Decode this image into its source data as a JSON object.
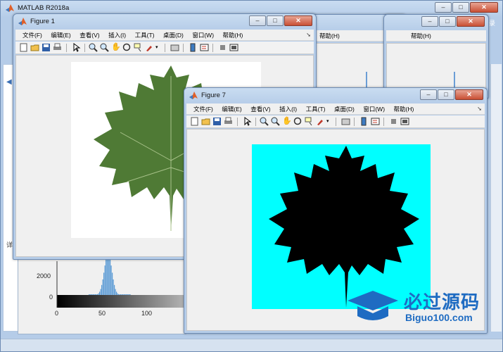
{
  "desktop": {
    "background_color": "#9ec4e4"
  },
  "matlab_window": {
    "title": "MATLAB R2018a",
    "login_fragment": "录"
  },
  "histogram_axes": {
    "y_ticks": [
      "2000",
      "0"
    ],
    "x_ticks": [
      "0",
      "50",
      "100"
    ],
    "bar_color": "#5b9bd5"
  },
  "menu_labels": {
    "file": "文件(F)",
    "edit": "编辑(E)",
    "view": "查看(V)",
    "insert": "插入(I)",
    "tools": "工具(T)",
    "desktop": "桌面(D)",
    "window": "窗口(W)",
    "help": "帮助(H)"
  },
  "figure1": {
    "title": "Figure 1",
    "image_description_icon": "maple-leaf-green"
  },
  "figure7": {
    "title": "Figure 7",
    "image_description_icon": "maple-leaf-silhouette",
    "background_color": "#00ffff"
  },
  "background_figures": {
    "help_label_1": "帮助(H)",
    "help_label_2": "帮助(H)"
  },
  "watermark": {
    "brand": "必过源码",
    "domain": "Biguo100.com",
    "color": "#1e6bc2"
  },
  "icons": [
    "matlab-logo-icon",
    "new-file-icon",
    "open-icon",
    "save-icon",
    "print-icon",
    "arrow-icon",
    "zoom-in-icon",
    "zoom-out-icon",
    "pan-icon",
    "rotate-icon",
    "data-cursor-icon",
    "brush-icon",
    "link-icon",
    "colorbar-icon",
    "legend-icon",
    "hide-plot-tools-icon",
    "show-plot-tools-icon"
  ]
}
